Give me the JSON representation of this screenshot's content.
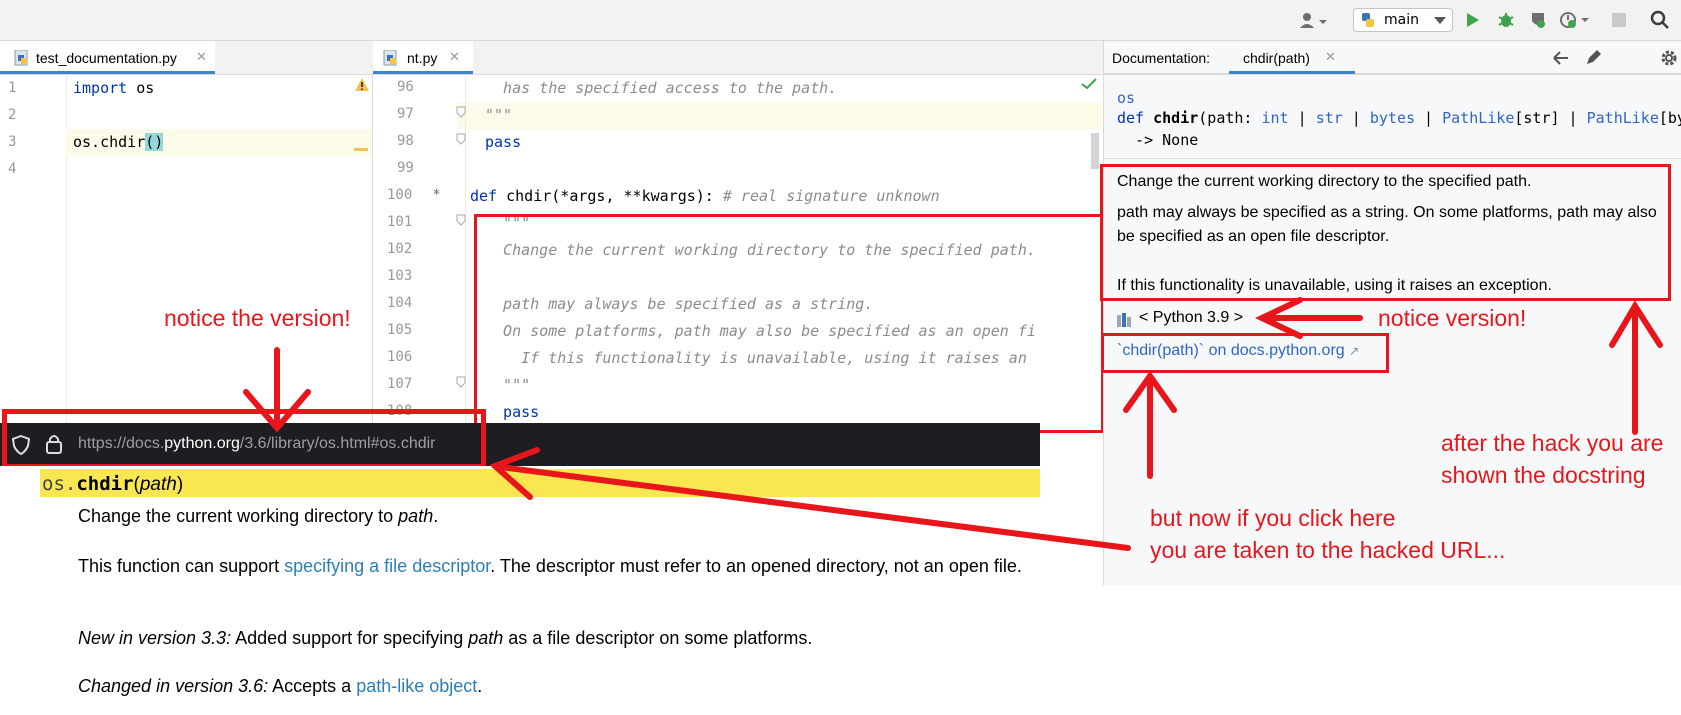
{
  "toolbar": {
    "branch_label": "main"
  },
  "tabs": {
    "left": "test_documentation.py",
    "middle": "nt.py",
    "doc_header": "Documentation:",
    "doc_tab": "chdir(path)"
  },
  "left_editor": {
    "line_numbers": [
      "1",
      "2",
      "3",
      "4"
    ],
    "line1_kw": "import",
    "line1_rest": " os",
    "line3_pre": "os.chdir",
    "line3_paren": "()"
  },
  "right_editor": {
    "line_numbers": [
      "96",
      "97",
      "98",
      "99",
      "100",
      "101",
      "102",
      "103",
      "104",
      "105",
      "106",
      "107",
      "108"
    ],
    "l96": "  has the specified access to the path.",
    "l97": "\"\"\"",
    "l98": "pass",
    "l100_kw": "def",
    "l100_name": " chdir(*args, **kwargs): ",
    "l100_comment": "# real signature unknown",
    "l101": "  \"\"\"",
    "l102": "  Change the current working directory to the specified path.",
    "l104": "  path may always be specified as a string.",
    "l105": "  On some platforms, path may also be specified as an open fi",
    "l106": "    If this functionality is unavailable, using it raises an",
    "l107": "  \"\"\"",
    "l108": "  pass"
  },
  "documentation": {
    "module": "os",
    "sig_def": "def ",
    "sig_name": "chdir",
    "sig_p1": "(path: ",
    "sig_int": "int",
    "sig_sep1": " | ",
    "sig_str": "str",
    "sig_sep2": " | ",
    "sig_bytes": "bytes",
    "sig_sep3": " | ",
    "sig_pl1": "PathLike",
    "sig_pl1b": "[str]",
    "sig_sep4": " | ",
    "sig_pl2": "PathLike",
    "sig_pl2b": "[by",
    "sig_ret": "  -> None",
    "p1": "Change the current working directory to the specified path.",
    "p2": "path may always be specified as a string. On some platforms, path may also be specified as an open file descriptor.",
    "p3": "If this functionality is unavailable, using it raises an exception.",
    "python_version": "< Python 3.9 >",
    "external_link": "`chdir(path)` on docs.python.org",
    "external_arrow": "↗"
  },
  "browser": {
    "url_prefix": "https://docs.",
    "url_domain": "python.org",
    "url_path": "/3.6/library/os.html#os.chdir",
    "heading_module": "os.",
    "heading_func": "chdir",
    "heading_args": "(",
    "heading_param": "path",
    "heading_close": ")",
    "d1_pre": "Change the current working directory to ",
    "d1_em": "path",
    "d1_post": ".",
    "d2_pre": "This function can support ",
    "d2_link": "specifying a file descriptor",
    "d2_post": ". The descriptor must refer to an opened directory, not an open file.",
    "d3_em": "New in version 3.3:",
    "d3_pre": " Added support for specifying ",
    "d3_em2": "path",
    "d3_post": " as a file descriptor on some platforms.",
    "d4_em": "Changed in version 3.6:",
    "d4_pre": " Accepts a ",
    "d4_link": "path-like object",
    "d4_post": "."
  },
  "annotations": {
    "notice_version_left": "notice the version!",
    "notice_version_right": "notice version!",
    "after_hack_1": "after the hack you are",
    "after_hack_2": "shown the docstring",
    "click_here_1": "but now if you click here",
    "click_here_2": "you are taken to the hacked URL..."
  },
  "colors": {
    "annotation_red": "#e8161b",
    "link_blue": "#2f65ca",
    "highlight_yellow": "#fae651",
    "tab_underline": "#4083c9"
  }
}
